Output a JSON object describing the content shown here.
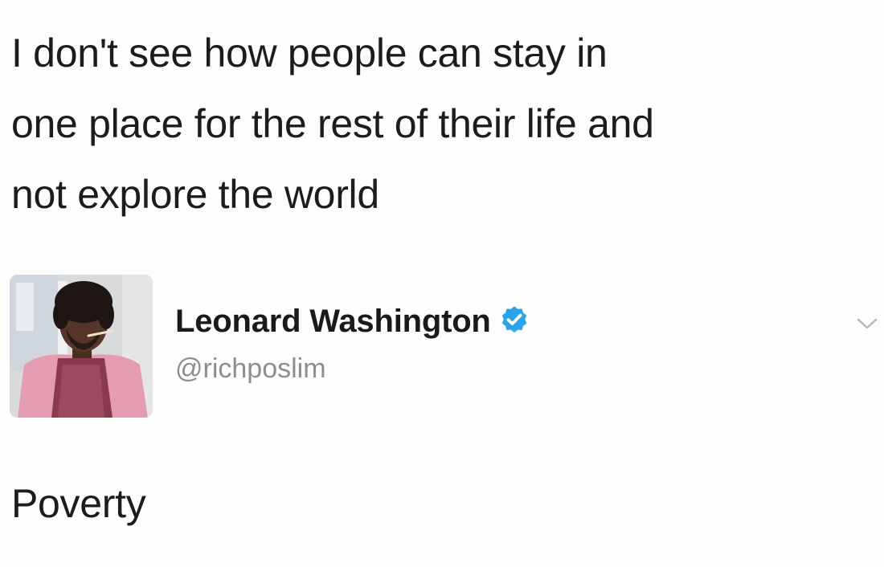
{
  "quoted_tweet": {
    "lines": [
      "I don't see how people can stay in",
      "one place for the rest of their life and",
      "not explore the world"
    ]
  },
  "author": {
    "display_name": "Leonard Washington",
    "handle": "@richposlim",
    "verified": true,
    "verified_color": "#1da1f2",
    "avatar_icon": "avatar-photo"
  },
  "reply": {
    "text": "Poverty"
  },
  "icons": {
    "menu": "chevron-down-icon"
  }
}
